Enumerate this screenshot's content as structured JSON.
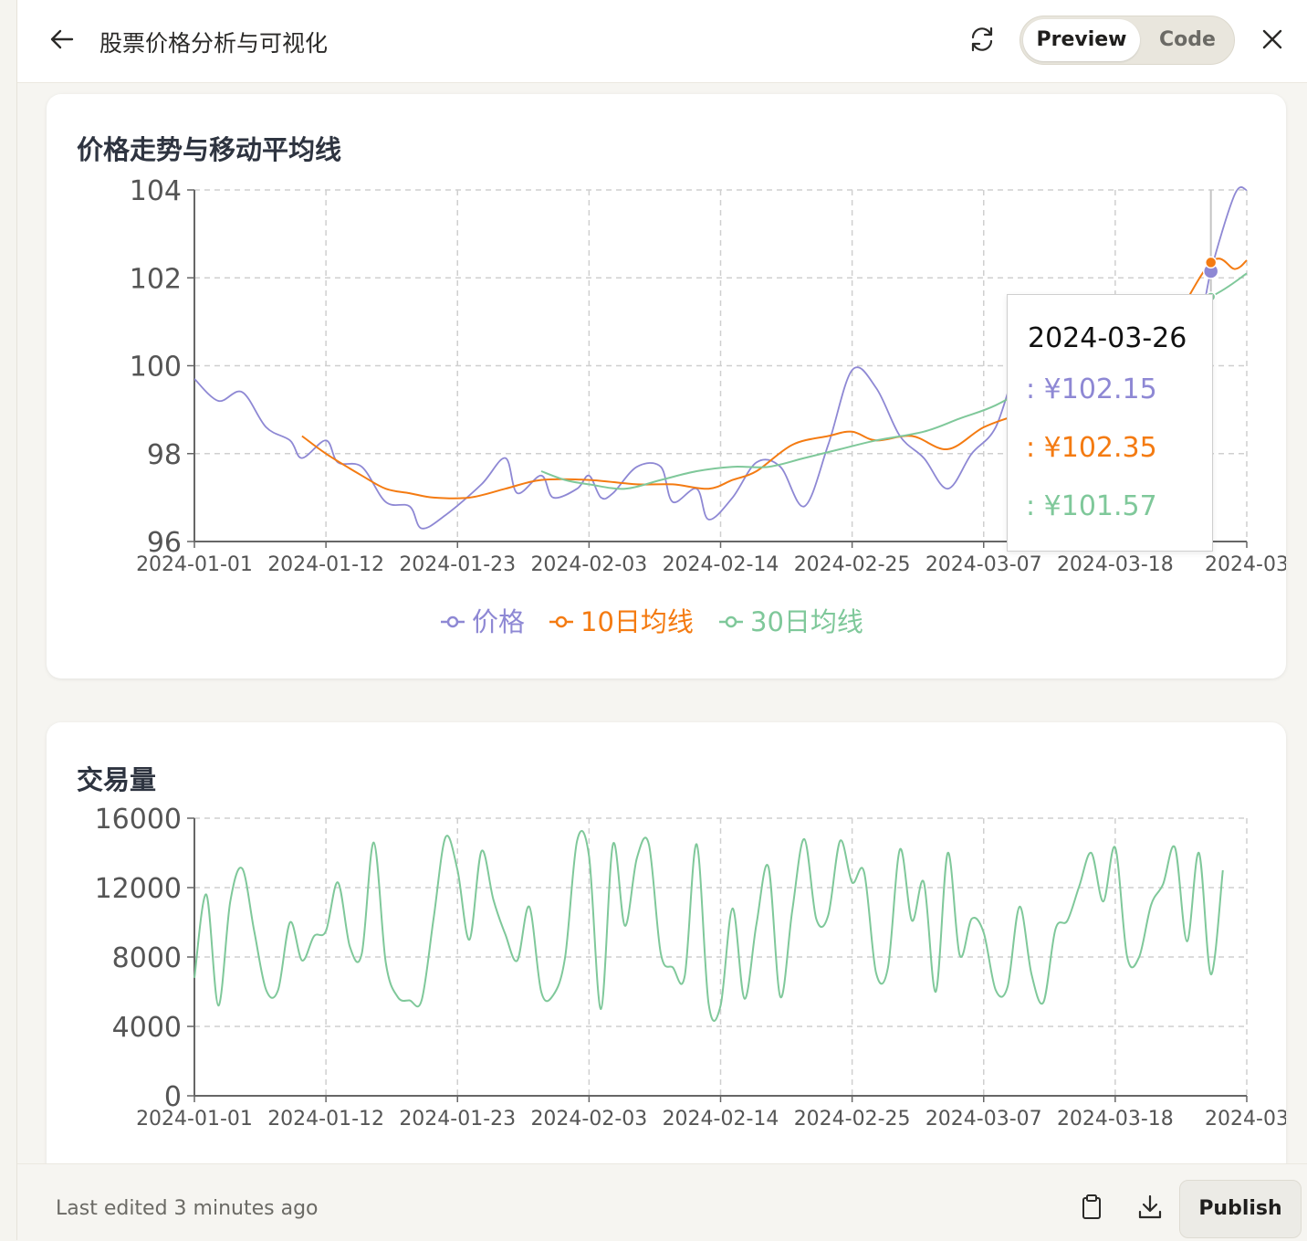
{
  "header": {
    "title": "股票价格分析与可视化",
    "tabs": [
      {
        "label": "Preview",
        "active": true
      },
      {
        "label": "Code",
        "active": false
      }
    ],
    "icons": {
      "back": "arrow-left-icon",
      "refresh": "refresh-icon",
      "close": "close-icon"
    }
  },
  "price_card": {
    "title": "价格走势与移动平均线"
  },
  "volume_card": {
    "title": "交易量"
  },
  "tooltip": {
    "date": "2024-03-26",
    "price": ": ¥102.15",
    "ma10": ": ¥102.35",
    "ma30": ": ¥101.57"
  },
  "colors": {
    "price": "#8e88d4",
    "ma10": "#f47b12",
    "ma30": "#7fc89a",
    "volume": "#7fc89a"
  },
  "chart_data": [
    {
      "type": "line",
      "title": "价格走势与移动平均线",
      "x_ticks": [
        "2024-01-01",
        "2024-01-12",
        "2024-01-23",
        "2024-02-03",
        "2024-02-14",
        "2024-02-25",
        "2024-03-07",
        "2024-03-18",
        "2024-03"
      ],
      "y_ticks": [
        "96",
        "98",
        "100",
        "102",
        "104"
      ],
      "ylim": [
        96,
        104
      ],
      "xlim": [
        "2024-01-01",
        "2024-03-29"
      ],
      "grid": true,
      "legend": "bottom",
      "series": [
        {
          "name": "价格",
          "points": [
            [
              "2024-01-01",
              99.7
            ],
            [
              "2024-01-03",
              99.2
            ],
            [
              "2024-01-05",
              99.4
            ],
            [
              "2024-01-07",
              98.6
            ],
            [
              "2024-01-09",
              98.3
            ],
            [
              "2024-01-10",
              97.9
            ],
            [
              "2024-01-12",
              98.3
            ],
            [
              "2024-01-13",
              97.8
            ],
            [
              "2024-01-15",
              97.7
            ],
            [
              "2024-01-17",
              96.9
            ],
            [
              "2024-01-19",
              96.8
            ],
            [
              "2024-01-20",
              96.3
            ],
            [
              "2024-01-22",
              96.6
            ],
            [
              "2024-01-25",
              97.3
            ],
            [
              "2024-01-27",
              97.9
            ],
            [
              "2024-01-28",
              97.1
            ],
            [
              "2024-01-30",
              97.5
            ],
            [
              "2024-01-31",
              97.0
            ],
            [
              "2024-02-02",
              97.2
            ],
            [
              "2024-02-03",
              97.5
            ],
            [
              "2024-02-04",
              97.0
            ],
            [
              "2024-02-05",
              97.1
            ],
            [
              "2024-02-07",
              97.7
            ],
            [
              "2024-02-09",
              97.7
            ],
            [
              "2024-02-10",
              96.9
            ],
            [
              "2024-02-12",
              97.2
            ],
            [
              "2024-02-13",
              96.5
            ],
            [
              "2024-02-15",
              97.0
            ],
            [
              "2024-02-17",
              97.8
            ],
            [
              "2024-02-19",
              97.7
            ],
            [
              "2024-02-21",
              96.8
            ],
            [
              "2024-02-23",
              98.2
            ],
            [
              "2024-02-25",
              99.9
            ],
            [
              "2024-02-27",
              99.5
            ],
            [
              "2024-02-29",
              98.4
            ],
            [
              "2024-03-02",
              97.9
            ],
            [
              "2024-03-04",
              97.2
            ],
            [
              "2024-03-06",
              98.0
            ],
            [
              "2024-03-08",
              98.6
            ],
            [
              "2024-03-10",
              100.1
            ],
            [
              "2024-03-12",
              100.3
            ],
            [
              "2024-03-14",
              98.7
            ],
            [
              "2024-03-16",
              98.8
            ],
            [
              "2024-03-17",
              99.4
            ],
            [
              "2024-03-18",
              99.0
            ],
            [
              "2024-03-20",
              99.2
            ],
            [
              "2024-03-22",
              99.9
            ],
            [
              "2024-03-24",
              100.9
            ],
            [
              "2024-03-25",
              100.8
            ],
            [
              "2024-03-26",
              102.15
            ],
            [
              "2024-03-28",
              103.9
            ],
            [
              "2024-03-29",
              104.0
            ]
          ]
        },
        {
          "name": "10日均线",
          "points": [
            [
              "2024-01-10",
              98.4
            ],
            [
              "2024-01-12",
              98.0
            ],
            [
              "2024-01-15",
              97.5
            ],
            [
              "2024-01-17",
              97.2
            ],
            [
              "2024-01-19",
              97.1
            ],
            [
              "2024-01-21",
              97.0
            ],
            [
              "2024-01-24",
              97.0
            ],
            [
              "2024-01-27",
              97.2
            ],
            [
              "2024-01-30",
              97.4
            ],
            [
              "2024-02-03",
              97.4
            ],
            [
              "2024-02-07",
              97.3
            ],
            [
              "2024-02-10",
              97.3
            ],
            [
              "2024-02-13",
              97.2
            ],
            [
              "2024-02-15",
              97.4
            ],
            [
              "2024-02-17",
              97.6
            ],
            [
              "2024-02-20",
              98.2
            ],
            [
              "2024-02-23",
              98.4
            ],
            [
              "2024-02-25",
              98.5
            ],
            [
              "2024-02-27",
              98.3
            ],
            [
              "2024-03-01",
              98.4
            ],
            [
              "2024-03-04",
              98.1
            ],
            [
              "2024-03-07",
              98.6
            ],
            [
              "2024-03-10",
              98.9
            ],
            [
              "2024-03-13",
              99.2
            ],
            [
              "2024-03-16",
              99.3
            ],
            [
              "2024-03-19",
              99.8
            ],
            [
              "2024-03-22",
              100.6
            ],
            [
              "2024-03-26",
              102.35
            ],
            [
              "2024-03-28",
              102.2
            ],
            [
              "2024-03-29",
              102.4
            ]
          ]
        },
        {
          "name": "30日均线",
          "points": [
            [
              "2024-01-30",
              97.6
            ],
            [
              "2024-02-01",
              97.4
            ],
            [
              "2024-02-03",
              97.3
            ],
            [
              "2024-02-06",
              97.2
            ],
            [
              "2024-02-09",
              97.4
            ],
            [
              "2024-02-12",
              97.6
            ],
            [
              "2024-02-15",
              97.7
            ],
            [
              "2024-02-18",
              97.7
            ],
            [
              "2024-02-21",
              97.9
            ],
            [
              "2024-02-24",
              98.1
            ],
            [
              "2024-02-27",
              98.3
            ],
            [
              "2024-03-02",
              98.5
            ],
            [
              "2024-03-05",
              98.8
            ],
            [
              "2024-03-08",
              99.1
            ],
            [
              "2024-03-12",
              99.7
            ],
            [
              "2024-03-16",
              100.3
            ],
            [
              "2024-03-20",
              100.9
            ],
            [
              "2024-03-26",
              101.57
            ],
            [
              "2024-03-29",
              102.1
            ]
          ]
        }
      ]
    },
    {
      "type": "line",
      "title": "交易量",
      "x_ticks": [
        "2024-01-01",
        "2024-01-12",
        "2024-01-23",
        "2024-02-03",
        "2024-02-14",
        "2024-02-25",
        "2024-03-07",
        "2024-03-18",
        "2024-03"
      ],
      "y_ticks": [
        "0",
        "4000",
        "8000",
        "12000",
        "16000"
      ],
      "ylim": [
        0,
        16000
      ],
      "xlim": [
        "2024-01-01",
        "2024-03-29"
      ],
      "grid": true,
      "series": [
        {
          "name": "",
          "values": [
            6800,
            11600,
            5200,
            11200,
            13100,
            9500,
            6100,
            6100,
            10000,
            7800,
            9200,
            9500,
            12300,
            8600,
            8200,
            14600,
            7700,
            5700,
            5500,
            5500,
            10200,
            14900,
            13000,
            9000,
            14100,
            11300,
            9300,
            7800,
            10900,
            6000,
            5800,
            8000,
            14700,
            13800,
            5000,
            14500,
            9800,
            13700,
            14500,
            8200,
            7400,
            6900,
            14500,
            5300,
            5200,
            10800,
            5600,
            9900,
            13200,
            5700,
            10700,
            14800,
            10200,
            10400,
            14700,
            12300,
            12900,
            7100,
            7400,
            14200,
            10100,
            12300,
            6000,
            14000,
            8100,
            10200,
            9400,
            6100,
            6300,
            10900,
            7000,
            5400,
            9600,
            10100,
            12100,
            14000,
            11200,
            14300,
            8000,
            8000,
            11000,
            12200,
            14300,
            8900,
            14000,
            7000,
            13000
          ]
        }
      ]
    }
  ],
  "footer": {
    "edited": "Last edited 3 minutes ago",
    "publish": "Publish",
    "icons": {
      "clipboard": "clipboard-icon",
      "download": "download-icon"
    }
  }
}
